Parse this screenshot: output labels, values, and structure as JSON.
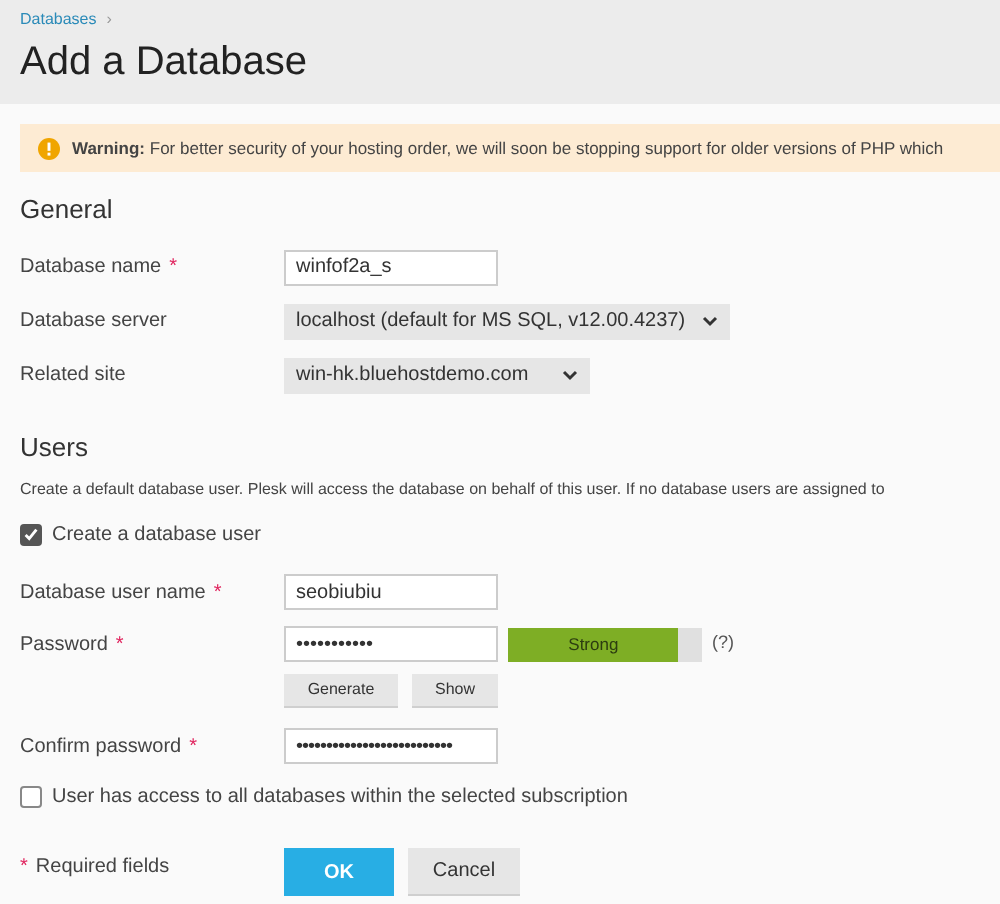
{
  "breadcrumb": {
    "items": [
      "Databases"
    ],
    "separator": "›"
  },
  "page_title": "Add a Database",
  "warning": {
    "label": "Warning:",
    "text": "For better security of your hosting order, we will soon be stopping support for older versions of PHP which"
  },
  "general": {
    "heading": "General",
    "fields": [
      {
        "kind": "input",
        "label": "Database name",
        "required": true,
        "value": "winfof2a_s"
      },
      {
        "kind": "select",
        "label": "Database server",
        "required": false,
        "value": "localhost (default for MS SQL, v12.00.4237)"
      },
      {
        "kind": "select",
        "label": "Related site",
        "required": false,
        "value": "win-hk.bluehostdemo.com"
      }
    ]
  },
  "users": {
    "heading": "Users",
    "description": "Create a default database user. Plesk will access the database on behalf of this user. If no database users are assigned to",
    "create_user": {
      "label": "Create a database user",
      "checked": true
    },
    "user_name": {
      "label": "Database user name",
      "required": true,
      "value": "seobiubiu"
    },
    "password": {
      "label": "Password",
      "required": true,
      "value": "•••••••••••",
      "strength": {
        "label": "Strong",
        "level": 0.88
      },
      "help": "(?)",
      "buttons": [
        "Generate",
        "Show"
      ]
    },
    "confirm_password": {
      "label": "Confirm password",
      "required": true,
      "value": "••••••••••••••••••••••••••"
    },
    "all_databases": {
      "label": "User has access to all databases within the selected subscription",
      "checked": false
    }
  },
  "footer": {
    "required_note": "Required fields",
    "required_mark": "*",
    "buttons": [
      {
        "label": "OK",
        "kind": "primary"
      },
      {
        "label": "Cancel",
        "kind": "secondary"
      }
    ]
  }
}
